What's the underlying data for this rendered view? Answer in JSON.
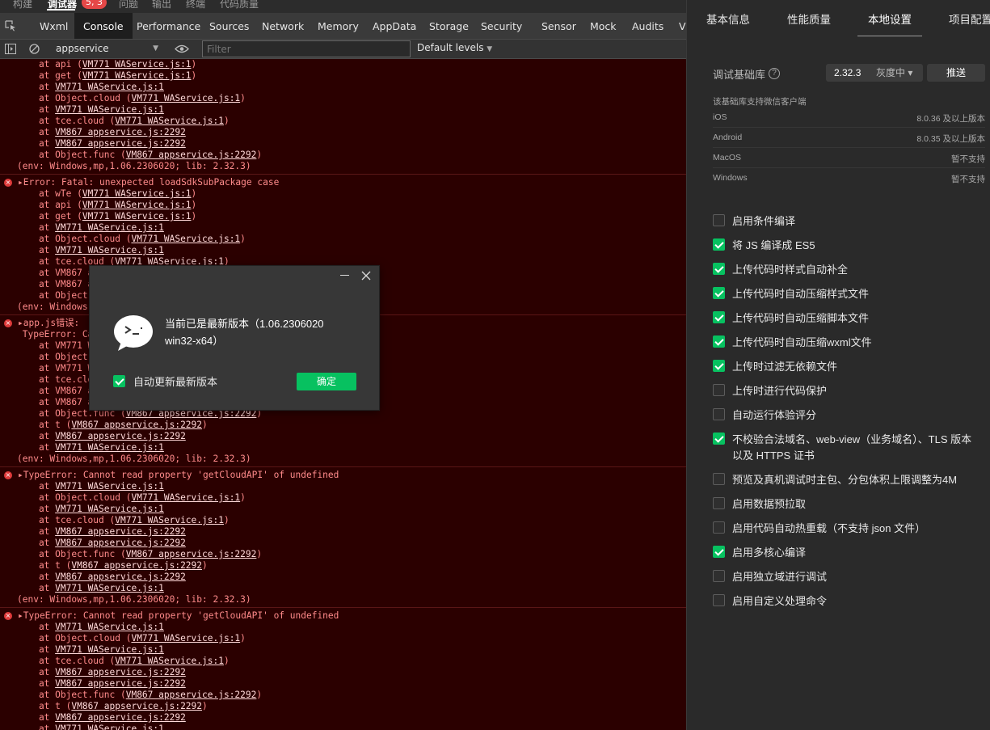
{
  "top_tabs": [
    {
      "label": "构建",
      "active": false
    },
    {
      "label": "调试器",
      "active": true
    },
    {
      "label": "问题",
      "active": false
    },
    {
      "label": "输出",
      "active": false
    },
    {
      "label": "终端",
      "active": false
    },
    {
      "label": "代码质量",
      "active": false
    }
  ],
  "error_badge": "5, 3",
  "panel_tabs": [
    {
      "label": "Wxml",
      "active": false
    },
    {
      "label": "Console",
      "active": true
    },
    {
      "label": "Performance",
      "active": false
    },
    {
      "label": "Sources",
      "active": false
    },
    {
      "label": "Network",
      "active": false
    },
    {
      "label": "Memory",
      "active": false
    },
    {
      "label": "AppData",
      "active": false
    },
    {
      "label": "Storage",
      "active": false
    },
    {
      "label": "Security",
      "active": false
    },
    {
      "label": "Sensor",
      "active": false
    },
    {
      "label": "Mock",
      "active": false
    },
    {
      "label": "Audits",
      "active": false
    },
    {
      "label": "Vi",
      "active": false
    }
  ],
  "console_toolbar": {
    "context": "appservice",
    "filter_placeholder": "Filter",
    "levels": "Default levels"
  },
  "console_lines": [
    {
      "text": "    at api (VM771 WAService.js:1)",
      "link": "VM771 WAService.js:1"
    },
    {
      "text": "    at get (VM771 WAService.js:1)",
      "link": "VM771 WAService.js:1"
    },
    {
      "text": "    at VM771 WAService.js:1",
      "link": "VM771 WAService.js:1"
    },
    {
      "text": "    at Object.cloud (VM771 WAService.js:1)",
      "link": "VM771 WAService.js:1"
    },
    {
      "text": "    at VM771 WAService.js:1",
      "link": "VM771 WAService.js:1"
    },
    {
      "text": "    at tce.cloud (VM771 WAService.js:1)",
      "link": "VM771 WAService.js:1"
    },
    {
      "text": "    at VM867 appservice.js:2292",
      "link": "VM867 appservice.js:2292"
    },
    {
      "text": "    at VM867 appservice.js:2292",
      "link": "VM867 appservice.js:2292"
    },
    {
      "text": "    at Object.func (VM867 appservice.js:2292)",
      "link": "VM867 appservice.js:2292"
    },
    {
      "text": "(env: Windows,mp,1.06.2306020; lib: 2.32.3)",
      "link": ""
    },
    {
      "text": "▸Error: Fatal: unexpected loadSdkSubPackage case",
      "link": "",
      "error": true
    },
    {
      "text": "    at wTe (VM771 WAService.js:1)",
      "link": "VM771 WAService.js:1"
    },
    {
      "text": "    at api (VM771 WAService.js:1)",
      "link": "VM771 WAService.js:1"
    },
    {
      "text": "    at get (VM771 WAService.js:1)",
      "link": "VM771 WAService.js:1"
    },
    {
      "text": "    at VM771 WAService.js:1",
      "link": "VM771 WAService.js:1"
    },
    {
      "text": "    at Object.cloud (VM771 WAService.js:1)",
      "link": "VM771 WAService.js:1"
    },
    {
      "text": "    at VM771 WAService.js:1",
      "link": "VM771 WAService.js:1"
    },
    {
      "text": "    at tce.cloud (VM771 WAService.js:1)",
      "link": "VM771 WAService.js:1"
    },
    {
      "text": "    at VM867 a",
      "link": ""
    },
    {
      "text": "    at VM867 a",
      "link": ""
    },
    {
      "text": "    at Object.",
      "link": ""
    },
    {
      "text": "(env: Windows,",
      "link": ""
    },
    {
      "text": "▸app.js错误:",
      "link": "",
      "error": true
    },
    {
      "text": " TypeError: Ca",
      "link": ""
    },
    {
      "text": "    at VM771 W",
      "link": ""
    },
    {
      "text": "    at Object.",
      "link": ""
    },
    {
      "text": "    at VM771 W",
      "link": ""
    },
    {
      "text": "    at tce.clo",
      "link": ""
    },
    {
      "text": "    at VM867 a",
      "link": ""
    },
    {
      "text": "    at VM867 a",
      "link": ""
    },
    {
      "text": "    at Object.func (VM867 appservice.js:2292)",
      "link": "VM867 appservice.js:2292"
    },
    {
      "text": "    at t (VM867 appservice.js:2292)",
      "link": "VM867 appservice.js:2292"
    },
    {
      "text": "    at VM867 appservice.js:2292",
      "link": "VM867 appservice.js:2292"
    },
    {
      "text": "    at VM771 WAService.js:1",
      "link": "VM771 WAService.js:1"
    },
    {
      "text": "(env: Windows,mp,1.06.2306020; lib: 2.32.3)",
      "link": ""
    },
    {
      "text": "▸TypeError: Cannot read property 'getCloudAPI' of undefined",
      "link": "",
      "error": true
    },
    {
      "text": "    at VM771 WAService.js:1",
      "link": "VM771 WAService.js:1"
    },
    {
      "text": "    at Object.cloud (VM771 WAService.js:1)",
      "link": "VM771 WAService.js:1"
    },
    {
      "text": "    at VM771 WAService.js:1",
      "link": "VM771 WAService.js:1"
    },
    {
      "text": "    at tce.cloud (VM771 WAService.js:1)",
      "link": "VM771 WAService.js:1"
    },
    {
      "text": "    at VM867 appservice.js:2292",
      "link": "VM867 appservice.js:2292"
    },
    {
      "text": "    at VM867 appservice.js:2292",
      "link": "VM867 appservice.js:2292"
    },
    {
      "text": "    at Object.func (VM867 appservice.js:2292)",
      "link": "VM867 appservice.js:2292"
    },
    {
      "text": "    at t (VM867 appservice.js:2292)",
      "link": "VM867 appservice.js:2292"
    },
    {
      "text": "    at VM867 appservice.js:2292",
      "link": "VM867 appservice.js:2292"
    },
    {
      "text": "    at VM771 WAService.js:1",
      "link": "VM771 WAService.js:1"
    },
    {
      "text": "(env: Windows,mp,1.06.2306020; lib: 2.32.3)",
      "link": ""
    },
    {
      "text": "▸TypeError: Cannot read property 'getCloudAPI' of undefined",
      "link": "",
      "error": true
    },
    {
      "text": "    at VM771 WAService.js:1",
      "link": "VM771 WAService.js:1"
    },
    {
      "text": "    at Object.cloud (VM771 WAService.js:1)",
      "link": "VM771 WAService.js:1"
    },
    {
      "text": "    at VM771 WAService.js:1",
      "link": "VM771 WAService.js:1"
    },
    {
      "text": "    at tce.cloud (VM771 WAService.js:1)",
      "link": "VM771 WAService.js:1"
    },
    {
      "text": "    at VM867 appservice.js:2292",
      "link": "VM867 appservice.js:2292"
    },
    {
      "text": "    at VM867 appservice.js:2292",
      "link": "VM867 appservice.js:2292"
    },
    {
      "text": "    at Object.func (VM867 appservice.js:2292)",
      "link": "VM867 appservice.js:2292"
    },
    {
      "text": "    at t (VM867 appservice.js:2292)",
      "link": "VM867 appservice.js:2292"
    },
    {
      "text": "    at VM867 appservice.js:2292",
      "link": "VM867 appservice.js:2292"
    },
    {
      "text": "    at VM771 WAService.js:1",
      "link": "VM771 WAService.js:1"
    }
  ],
  "right_tabs": [
    {
      "label": "基本信息",
      "active": false
    },
    {
      "label": "性能质量",
      "active": false
    },
    {
      "label": "本地设置",
      "active": true
    },
    {
      "label": "项目配置",
      "active": false
    }
  ],
  "base_lib": {
    "label": "调试基础库",
    "version": "2.32.3",
    "gray": "灰度中 ▾",
    "push_label": "推送"
  },
  "client_support": {
    "title": "该基础库支持微信客户端",
    "rows": [
      {
        "name": "iOS",
        "value": "8.0.36 及以上版本"
      },
      {
        "name": "Android",
        "value": "8.0.35 及以上版本"
      },
      {
        "name": "MacOS",
        "value": "暂不支持"
      },
      {
        "name": "Windows",
        "value": "暂不支持"
      }
    ]
  },
  "options": [
    {
      "label": "启用条件编译",
      "checked": false
    },
    {
      "label": "将 JS 编译成 ES5",
      "checked": true
    },
    {
      "label": "上传代码时样式自动补全",
      "checked": true
    },
    {
      "label": "上传代码时自动压缩样式文件",
      "checked": true
    },
    {
      "label": "上传代码时自动压缩脚本文件",
      "checked": true
    },
    {
      "label": "上传代码时自动压缩wxml文件",
      "checked": true
    },
    {
      "label": "上传时过滤无依赖文件",
      "checked": true
    },
    {
      "label": "上传时进行代码保护",
      "checked": false
    },
    {
      "label": "自动运行体验评分",
      "checked": false
    },
    {
      "label": "不校验合法域名、web-view（业务域名）、TLS 版本以及 HTTPS 证书",
      "checked": true
    },
    {
      "label": "预览及真机调试时主包、分包体积上限调整为4M",
      "checked": false
    },
    {
      "label": "启用数据预拉取",
      "checked": false
    },
    {
      "label": "启用代码自动热重载（不支持 json 文件）",
      "checked": false
    },
    {
      "label": "启用多核心编译",
      "checked": true
    },
    {
      "label": "启用独立域进行调试",
      "checked": false
    },
    {
      "label": "启用自定义处理命令",
      "checked": false
    }
  ],
  "dialog": {
    "message": "当前已是最新版本（1.06.2306020 win32-x64）",
    "auto_update_label": "自动更新最新版本",
    "auto_update_checked": true,
    "confirm_label": "确定"
  },
  "colors": {
    "accent_green": "#07c160",
    "console_error_bg": "#2b0000",
    "console_error_text": "#ff8b8b"
  }
}
